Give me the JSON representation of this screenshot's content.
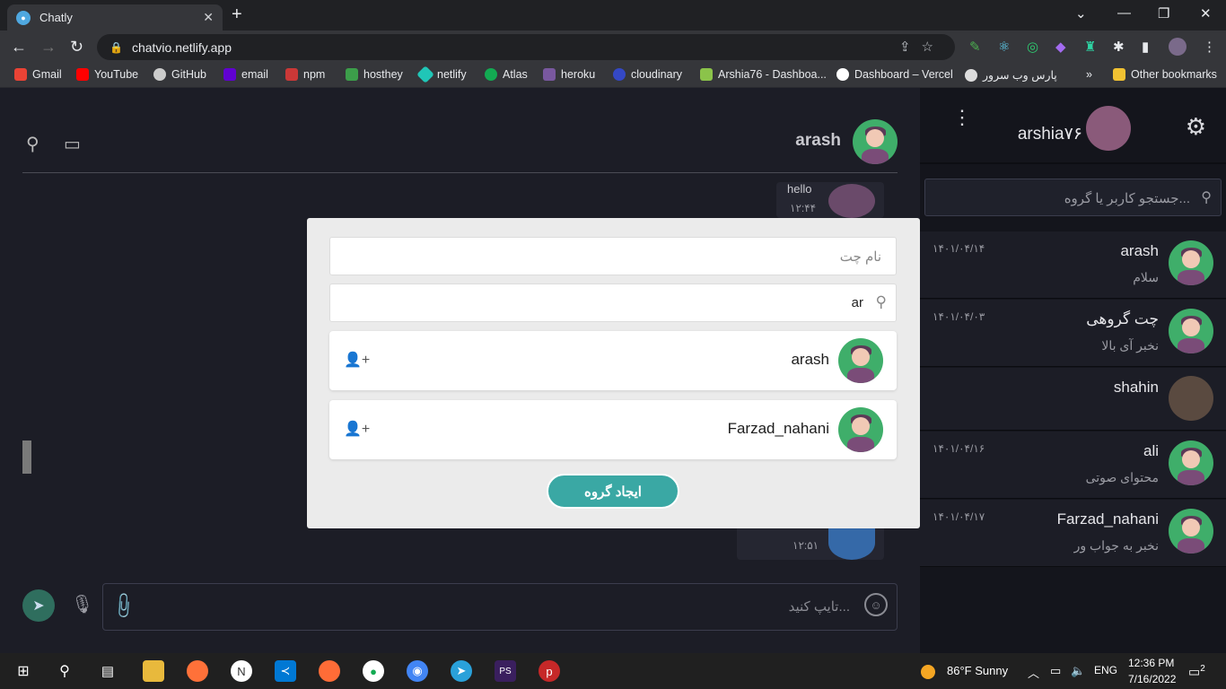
{
  "browser": {
    "tab_title": "Chatly",
    "url": "chatvio.netlify.app",
    "bookmarks": [
      "Gmail",
      "YouTube",
      "GitHub",
      "email",
      "npm",
      "hosthey",
      "netlify",
      "Atlas",
      "heroku",
      "cloudinary",
      "Arshia76 - Dashboa...",
      "Dashboard – Vercel",
      "پارس وب سرور"
    ],
    "more": "»",
    "other": "Other bookmarks"
  },
  "chat": {
    "contact": "arash",
    "messages": [
      {
        "text": "hello",
        "time": "۱۲:۴۴"
      },
      {
        "text": "",
        "time": "۱۲:۵۱"
      }
    ],
    "input_placeholder": "تایپ کنید..."
  },
  "sidebar": {
    "username": "arshia۷۶",
    "search_placeholder": "جستجو کاربر یا گروه...",
    "conversations": [
      {
        "name": "arash",
        "snippet": "سلام",
        "date": "۱۴۰۱/۰۴/۱۴"
      },
      {
        "name": "چت گروهی",
        "snippet": "نخبر آی بالا",
        "date": "۱۴۰۱/۰۴/۰۳"
      },
      {
        "name": "shahin",
        "snippet": "",
        "date": ""
      },
      {
        "name": "ali",
        "snippet": "محتوای صوتی",
        "date": "۱۴۰۱/۰۴/۱۶"
      },
      {
        "name": "Farzad_nahani",
        "snippet": "نخبر به جواب ور",
        "date": "۱۴۰۱/۰۴/۱۷"
      }
    ]
  },
  "modal": {
    "chat_name_placeholder": "نام چت",
    "search_value": "ar",
    "users": [
      {
        "name": "arash"
      },
      {
        "name": "Farzad_nahani"
      }
    ],
    "create_button": "ایجاد گروه"
  },
  "taskbar": {
    "weather": "86°F  Sunny",
    "lang": "ENG",
    "time": "12:36 PM",
    "date": "7/16/2022",
    "notif": "2"
  }
}
